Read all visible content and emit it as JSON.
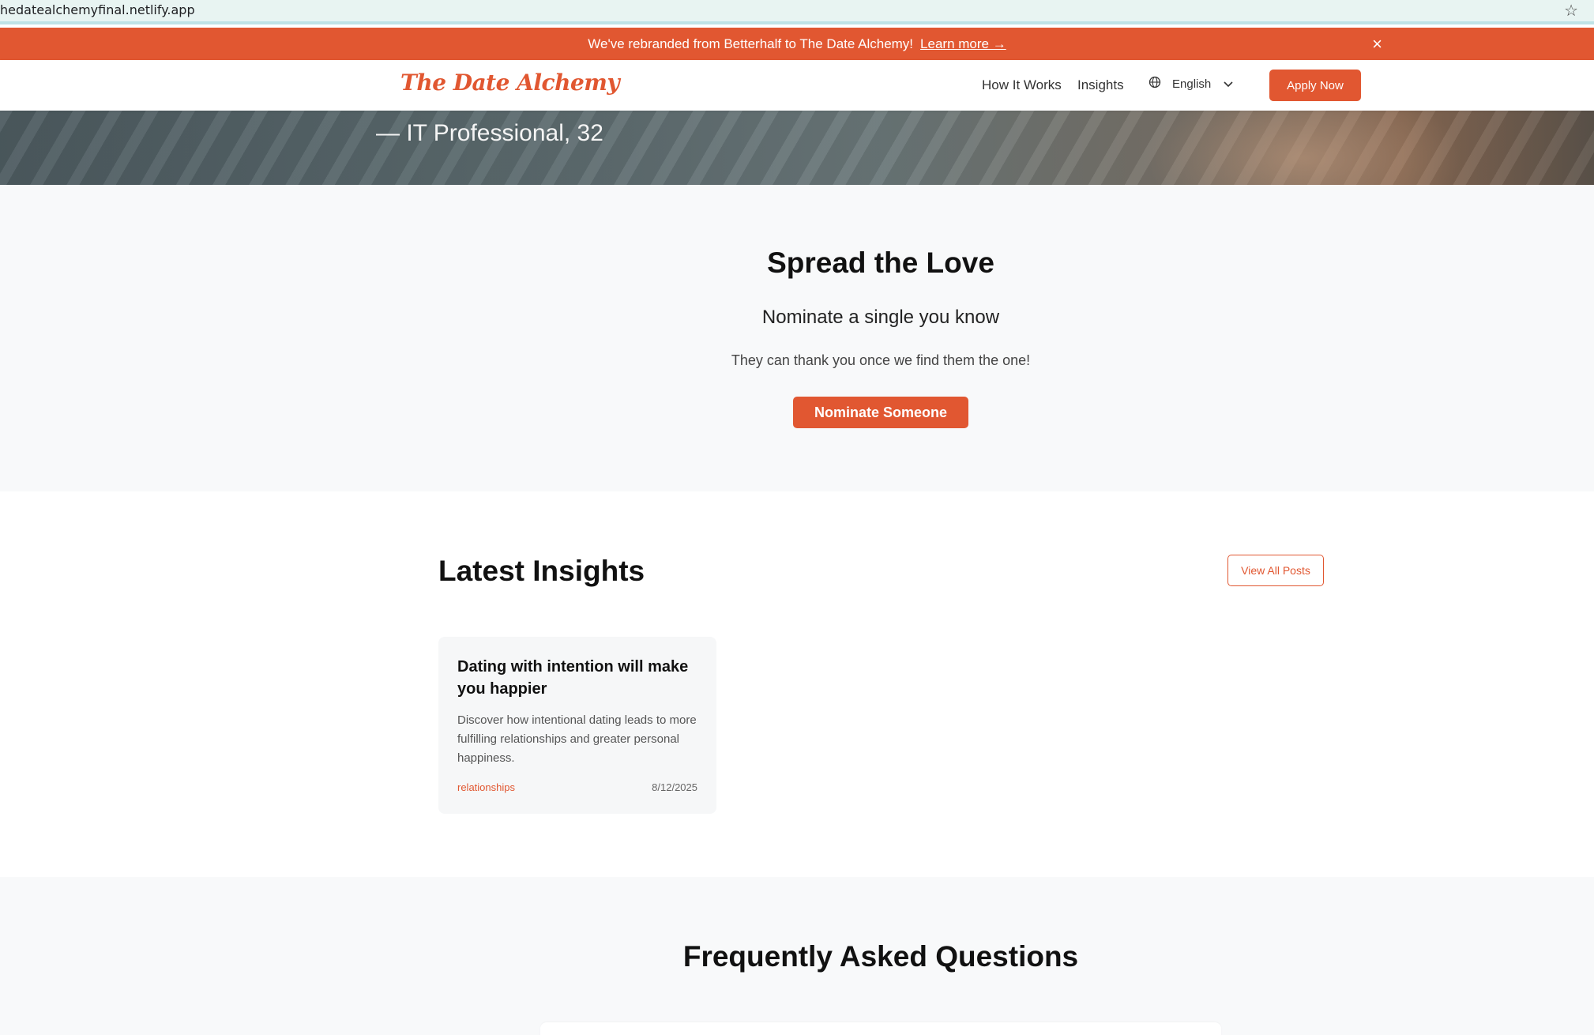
{
  "browser": {
    "url": "hedatealchemyfinal.netlify.app"
  },
  "announcement": {
    "text": "We've rebranded from Betterhalf to The Date Alchemy!",
    "link_label": "Learn more →",
    "close_icon": "×"
  },
  "nav": {
    "logo": "The Date Alchemy",
    "links": [
      "How It Works",
      "Insights"
    ],
    "language": "English",
    "apply_label": "Apply Now"
  },
  "hero": {
    "attribution": "— IT Professional, 32"
  },
  "spread": {
    "title": "Spread the Love",
    "subtitle": "Nominate a single you know",
    "description": "They can thank you once we find them the one!",
    "button_label": "Nominate Someone"
  },
  "insights": {
    "title": "Latest Insights",
    "view_all_label": "View All Posts",
    "posts": [
      {
        "title": "Dating with intention will make you happier",
        "excerpt": "Discover how intentional dating leads to more fulfilling relationships and greater personal happiness.",
        "tag": "relationships",
        "date": "8/12/2025"
      }
    ]
  },
  "faq": {
    "title": "Frequently Asked Questions"
  },
  "colors": {
    "accent": "#e15731",
    "section_bg": "#f8f9fa"
  }
}
